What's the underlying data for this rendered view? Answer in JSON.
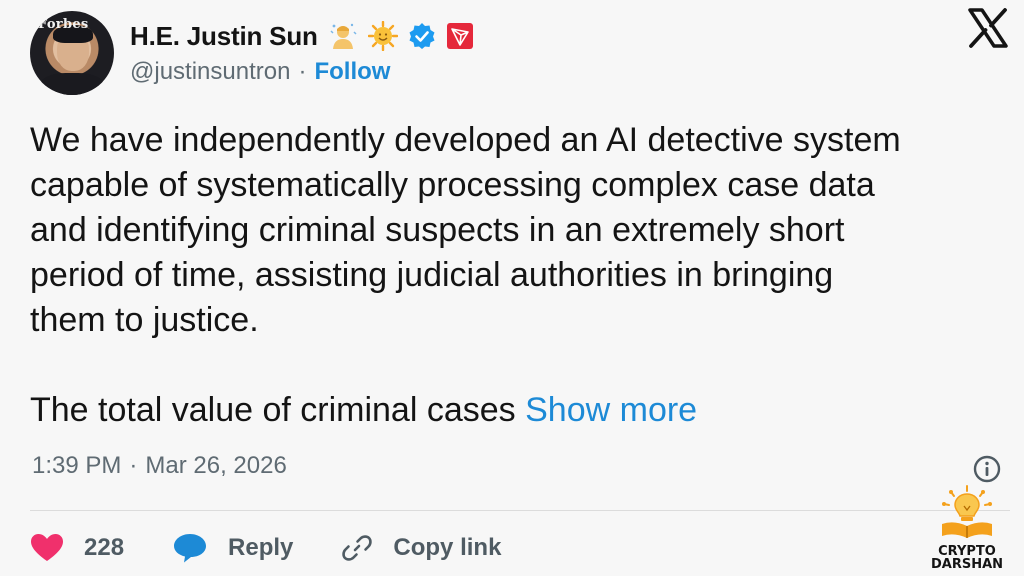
{
  "author": {
    "display_name": "H.E. Justin Sun",
    "avatar_text": "Forbes",
    "handle": "@justinsuntron",
    "separator": "·",
    "follow_label": "Follow",
    "badges": [
      "person-emoji-icon",
      "sun-emoji-icon",
      "verified-badge-icon",
      "tron-logo-icon"
    ]
  },
  "platform_icon": "x-logo-icon",
  "tweet": {
    "lines": [
      "We have independently developed an AI detective system",
      "capable of systematically processing complex case data",
      "and identifying criminal suspects in an extremely short",
      "period of time, assisting judicial authorities in bringing",
      "them to justice."
    ],
    "truncated_text": "The total value of criminal cases",
    "show_more_label": "Show more"
  },
  "meta": {
    "time": "1:39 PM",
    "separator": "·",
    "date": "Mar 26, 2026"
  },
  "actions": {
    "likes": "228",
    "reply_label": "Reply",
    "copy_link_label": "Copy link"
  },
  "watermark": {
    "line1": "CRYPTO",
    "line2": "DARSHAN"
  },
  "colors": {
    "link_blue": "#1d8ad6",
    "heart_pink": "#f0306c",
    "reply_blue": "#1d8ad6",
    "verified_blue": "#1d9bf0",
    "tron_red": "#e5283b",
    "background": "#f7f7f7"
  }
}
